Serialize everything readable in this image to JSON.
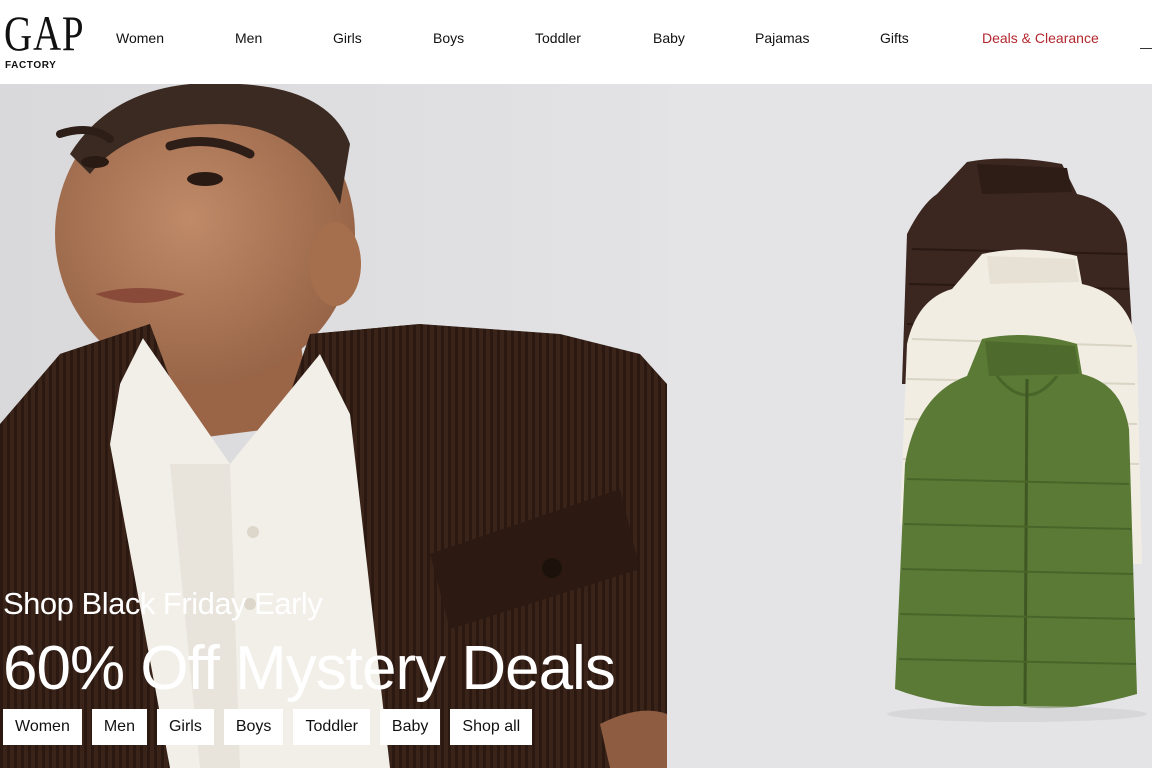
{
  "brand": {
    "name": "GAP",
    "sub": "FACTORY"
  },
  "nav": {
    "items": [
      {
        "label": "Women"
      },
      {
        "label": "Men"
      },
      {
        "label": "Girls"
      },
      {
        "label": "Boys"
      },
      {
        "label": "Toddler"
      },
      {
        "label": "Baby"
      },
      {
        "label": "Pajamas"
      },
      {
        "label": "Gifts"
      },
      {
        "label": "Deals & Clearance"
      }
    ],
    "deals_color": "#b3272e"
  },
  "hero": {
    "eyebrow": "Shop Black Friday Early",
    "headline": "60% Off Mystery Deals",
    "chips": [
      {
        "label": "Women"
      },
      {
        "label": "Men"
      },
      {
        "label": "Girls"
      },
      {
        "label": "Boys"
      },
      {
        "label": "Toddler"
      },
      {
        "label": "Baby"
      },
      {
        "label": "Shop all"
      }
    ]
  },
  "colors": {
    "jacket": "#3a241a",
    "vest_brown": "#3b2620",
    "vest_cream": "#f1ede3",
    "vest_green": "#5b7a35"
  }
}
